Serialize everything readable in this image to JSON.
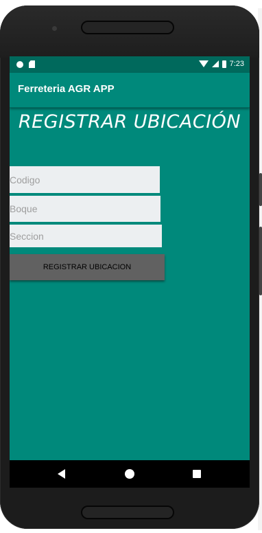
{
  "status_bar": {
    "time": "7:23"
  },
  "app_bar": {
    "title": "Ferreteria AGR APP"
  },
  "page": {
    "heading": "REGISTRAR UBICACIÓN"
  },
  "form": {
    "codigo_placeholder": "Codigo",
    "bloque_placeholder": "Boque",
    "seccion_placeholder": "Seccion",
    "submit_label": "REGISTRAR UBICACION"
  },
  "colors": {
    "primary": "#00897b",
    "primary_dark": "#00695c",
    "field_background": "#eceff1",
    "button_background": "#616161"
  },
  "icons": {
    "status_left": [
      "notification-dot-icon",
      "sd-card-icon"
    ],
    "status_right": [
      "wifi-icon",
      "signal-icon",
      "battery-icon"
    ],
    "navigation": [
      "back-icon",
      "home-icon",
      "recents-icon"
    ]
  }
}
